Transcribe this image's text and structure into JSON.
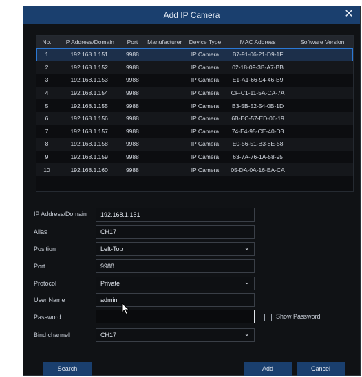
{
  "dialog": {
    "title": "Add IP Camera",
    "close_glyph": "✕"
  },
  "table": {
    "headers": [
      "No.",
      "IP Address/Domain",
      "Port",
      "Manufacturer",
      "Device Type",
      "MAC Address",
      "Software Version"
    ],
    "rows": [
      {
        "no": "1",
        "ip": "192.168.1.151",
        "port": "9988",
        "manufacturer": "",
        "device_type": "IP Camera",
        "mac": "B7-91-06-21-D9-1F",
        "software_version": ""
      },
      {
        "no": "2",
        "ip": "192.168.1.152",
        "port": "9988",
        "manufacturer": "",
        "device_type": "IP Camera",
        "mac": "02-18-09-3B-A7-BB",
        "software_version": ""
      },
      {
        "no": "3",
        "ip": "192.168.1.153",
        "port": "9988",
        "manufacturer": "",
        "device_type": "IP Camera",
        "mac": "E1-A1-66-94-46-B9",
        "software_version": ""
      },
      {
        "no": "4",
        "ip": "192.168.1.154",
        "port": "9988",
        "manufacturer": "",
        "device_type": "IP Camera",
        "mac": "CF-C1-11-5A-CA-7A",
        "software_version": ""
      },
      {
        "no": "5",
        "ip": "192.168.1.155",
        "port": "9988",
        "manufacturer": "",
        "device_type": "IP Camera",
        "mac": "B3-5B-52-54-0B-1D",
        "software_version": ""
      },
      {
        "no": "6",
        "ip": "192.168.1.156",
        "port": "9988",
        "manufacturer": "",
        "device_type": "IP Camera",
        "mac": "6B-EC-57-ED-06-19",
        "software_version": ""
      },
      {
        "no": "7",
        "ip": "192.168.1.157",
        "port": "9988",
        "manufacturer": "",
        "device_type": "IP Camera",
        "mac": "74-E4-95-CE-40-D3",
        "software_version": ""
      },
      {
        "no": "8",
        "ip": "192.168.1.158",
        "port": "9988",
        "manufacturer": "",
        "device_type": "IP Camera",
        "mac": "E0-56-51-B3-8E-58",
        "software_version": ""
      },
      {
        "no": "9",
        "ip": "192.168.1.159",
        "port": "9988",
        "manufacturer": "",
        "device_type": "IP Camera",
        "mac": "63-7A-76-1A-58-95",
        "software_version": ""
      },
      {
        "no": "10",
        "ip": "192.168.1.160",
        "port": "9988",
        "manufacturer": "",
        "device_type": "IP Camera",
        "mac": "05-DA-0A-16-EA-CA",
        "software_version": ""
      }
    ],
    "selected_row": 1
  },
  "form": {
    "ip_label": "IP Address/Domain",
    "ip_value": "192.168.1.151",
    "alias_label": "Alias",
    "alias_value": "CH17",
    "position_label": "Position",
    "position_value": "Left-Top",
    "port_label": "Port",
    "port_value": "9988",
    "protocol_label": "Protocol",
    "protocol_value": "Private",
    "username_label": "User Name",
    "username_value": "admin",
    "password_label": "Password",
    "password_value": "",
    "show_password_label": "Show Password",
    "bind_label": "Bind channel",
    "bind_value": "CH17",
    "dropdown_glyph": "⌄"
  },
  "buttons": {
    "search": "Search",
    "add": "Add",
    "cancel": "Cancel"
  },
  "colors": {
    "titlebar": "#1a3f6e",
    "selection": "#2b78d4",
    "background": "#101215"
  }
}
